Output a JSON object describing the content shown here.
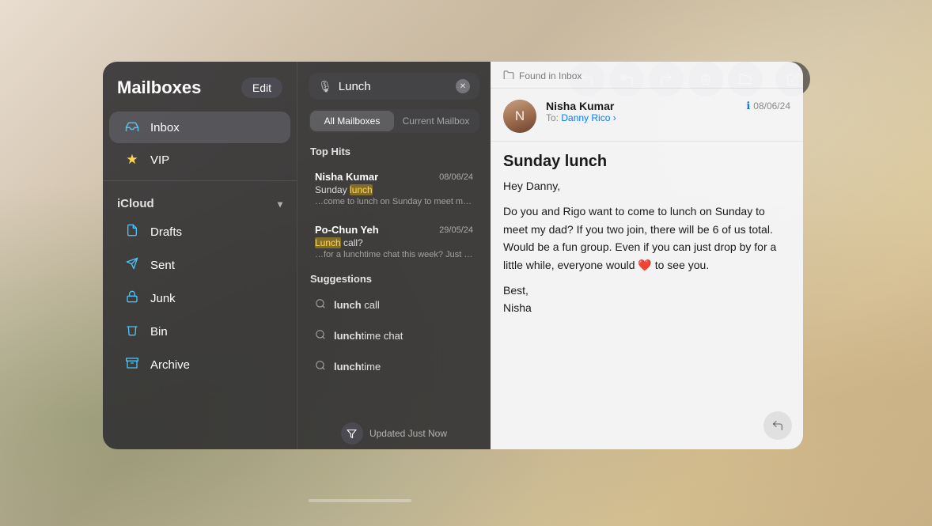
{
  "background": {
    "description": "Blurred room interior with warm tones"
  },
  "toolbar": {
    "buttons": [
      {
        "name": "reply-button",
        "icon": "↩",
        "label": "Reply"
      },
      {
        "name": "reply-all-button",
        "icon": "↩↩",
        "label": "Reply All"
      },
      {
        "name": "forward-button",
        "icon": "↪",
        "label": "Forward"
      },
      {
        "name": "delete-button",
        "icon": "🗑",
        "label": "Delete"
      },
      {
        "name": "move-button",
        "icon": "📁",
        "label": "Move to Mailbox"
      },
      {
        "name": "compose-button",
        "icon": "✏",
        "label": "Compose"
      }
    ]
  },
  "mailboxes": {
    "title": "Mailboxes",
    "edit_label": "Edit",
    "items": [
      {
        "name": "Inbox",
        "icon": "inbox",
        "active": true
      },
      {
        "name": "VIP",
        "icon": "star",
        "active": false
      }
    ],
    "sections": [
      {
        "name": "iCloud",
        "collapsed": false,
        "items": [
          {
            "name": "Drafts",
            "icon": "drafts"
          },
          {
            "name": "Sent",
            "icon": "sent"
          },
          {
            "name": "Junk",
            "icon": "junk"
          },
          {
            "name": "Bin",
            "icon": "bin"
          },
          {
            "name": "Archive",
            "icon": "archive"
          }
        ]
      }
    ]
  },
  "search": {
    "query": "Lunch",
    "placeholder": "Search",
    "tabs": [
      {
        "label": "All Mailboxes",
        "active": true
      },
      {
        "label": "Current Mailbox",
        "active": false
      }
    ],
    "top_hits_label": "Top Hits",
    "results": [
      {
        "sender": "Nisha Kumar",
        "date": "08/06/24",
        "subject_parts": [
          {
            "text": "Sunday "
          },
          {
            "text": "lunch",
            "highlight": true
          }
        ],
        "preview": "…come to lunch on Sunday to meet my da…"
      },
      {
        "sender": "Po-Chun Yeh",
        "date": "29/05/24",
        "subject_parts": [
          {
            "text": "Lunch",
            "highlight": true
          },
          {
            "text": " call?"
          }
        ],
        "preview": "…for a lunchtime chat this week? Just let…"
      }
    ],
    "suggestions_label": "Suggestions",
    "suggestions": [
      {
        "text_bold": "lunch",
        "text_rest": " call"
      },
      {
        "text_bold": "lunch",
        "text_rest": "time chat"
      },
      {
        "text_bold": "lunch",
        "text_rest": "time"
      }
    ],
    "status": "Updated Just Now"
  },
  "email": {
    "found_in": "Found in Inbox",
    "sender_name": "Nisha Kumar",
    "to_label": "To:",
    "to_name": "Danny Rico",
    "date": "08/06/24",
    "subject": "Sunday lunch",
    "body_lines": [
      "Hey Danny,",
      "Do you and Rigo want to come to lunch on Sunday to meet my dad? If you two join, there will be 6 of us total. Would be a fun group. Even if you can just drop by for a little while, everyone would ❤️ to see you.",
      "Best,",
      "Nisha"
    ]
  }
}
